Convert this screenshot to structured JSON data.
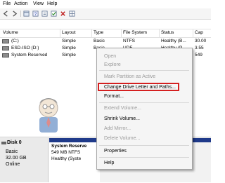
{
  "menubar": {
    "items": [
      "File",
      "Action",
      "View",
      "Help"
    ]
  },
  "toolbar": {
    "icons": [
      "back-icon",
      "forward-icon",
      "console-icon",
      "help-icon",
      "properties-icon",
      "check-icon",
      "delete-icon",
      "grid-icon"
    ]
  },
  "columns": [
    "Volume",
    "Layout",
    "Type",
    "File System",
    "Status",
    "Cap"
  ],
  "volumes": [
    {
      "volume": "(C:)",
      "layout": "Simple",
      "type": "Basic",
      "fs": "NTFS",
      "status": "Healthy (B...",
      "cap": "30.00"
    },
    {
      "volume": "ESD-ISO (D:)",
      "layout": "Simple",
      "type": "Basic",
      "fs": "UDF",
      "status": "Healthy (P...",
      "cap": "3.55"
    },
    {
      "volume": "System Reserved",
      "layout": "Simple",
      "type": "",
      "fs": "",
      "status": "",
      "cap": "549"
    }
  ],
  "context_menu": {
    "items": [
      {
        "label": "Open",
        "enabled": false
      },
      {
        "label": "Explore",
        "enabled": false
      },
      {
        "label": "Mark Partition as Active",
        "enabled": false
      },
      {
        "label": "Change Drive Letter and Paths...",
        "enabled": true
      },
      {
        "label": "Format...",
        "enabled": true
      },
      {
        "label": "Extend Volume...",
        "enabled": false
      },
      {
        "label": "Shrink Volume...",
        "enabled": true
      },
      {
        "label": "Add Mirror...",
        "enabled": false
      },
      {
        "label": "Delete Volume...",
        "enabled": false
      },
      {
        "label": "Properties",
        "enabled": true
      },
      {
        "label": "Help",
        "enabled": true
      }
    ]
  },
  "disk": {
    "name": "Disk 0",
    "type": "Basic",
    "size": "32.00 GB",
    "status": "Online"
  },
  "partition": {
    "name": "System Reserve",
    "size": "549 MB NTFS",
    "status": "Healthy (Syste"
  },
  "colors": {
    "highlight": "#d42020",
    "partition_bar": "#1f3a8a"
  }
}
